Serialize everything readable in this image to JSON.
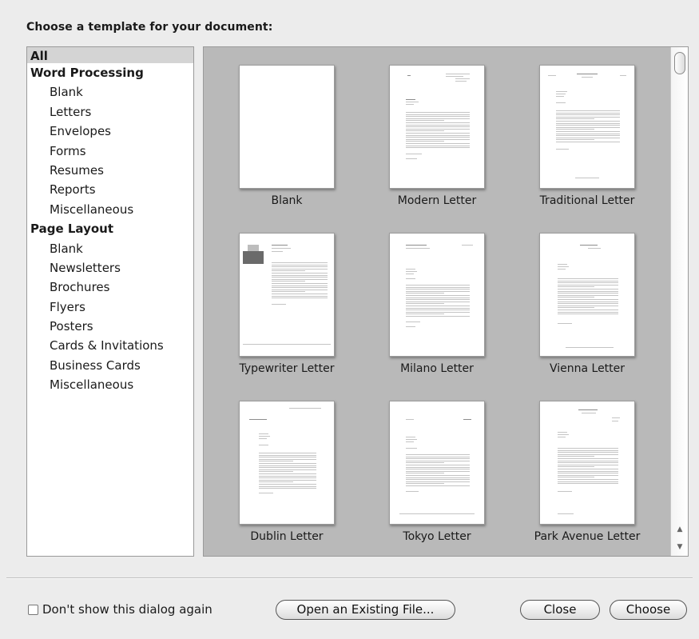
{
  "dialog": {
    "title": "Choose a template for your document:"
  },
  "sidebar": {
    "items": [
      {
        "label": "All",
        "kind": "top",
        "selected": true
      },
      {
        "label": "Word Processing",
        "kind": "group"
      },
      {
        "label": "Blank",
        "kind": "child"
      },
      {
        "label": "Letters",
        "kind": "child"
      },
      {
        "label": "Envelopes",
        "kind": "child"
      },
      {
        "label": "Forms",
        "kind": "child"
      },
      {
        "label": "Resumes",
        "kind": "child"
      },
      {
        "label": "Reports",
        "kind": "child"
      },
      {
        "label": "Miscellaneous",
        "kind": "child"
      },
      {
        "label": "Page Layout",
        "kind": "group"
      },
      {
        "label": "Blank",
        "kind": "child"
      },
      {
        "label": "Newsletters",
        "kind": "child"
      },
      {
        "label": "Brochures",
        "kind": "child"
      },
      {
        "label": "Flyers",
        "kind": "child"
      },
      {
        "label": "Posters",
        "kind": "child"
      },
      {
        "label": "Cards & Invitations",
        "kind": "child"
      },
      {
        "label": "Business Cards",
        "kind": "child"
      },
      {
        "label": "Miscellaneous",
        "kind": "child"
      }
    ]
  },
  "templates": [
    {
      "name": "Blank",
      "style": "blank"
    },
    {
      "name": "Modern Letter",
      "style": "modern"
    },
    {
      "name": "Traditional Letter",
      "style": "traditional"
    },
    {
      "name": "Typewriter Letter",
      "style": "typewriter"
    },
    {
      "name": "Milano Letter",
      "style": "milano"
    },
    {
      "name": "Vienna Letter",
      "style": "vienna"
    },
    {
      "name": "Dublin Letter",
      "style": "dublin"
    },
    {
      "name": "Tokyo Letter",
      "style": "tokyo"
    },
    {
      "name": "Park Avenue Letter",
      "style": "parkavenue"
    }
  ],
  "footer": {
    "dont_show_label": "Don't show this dialog again",
    "open_existing_label": "Open an Existing File...",
    "close_label": "Close",
    "choose_label": "Choose"
  },
  "colors": {
    "window_bg": "#ececec",
    "gallery_bg": "#b9b9b9",
    "selection_bg": "#d4d4d4"
  }
}
